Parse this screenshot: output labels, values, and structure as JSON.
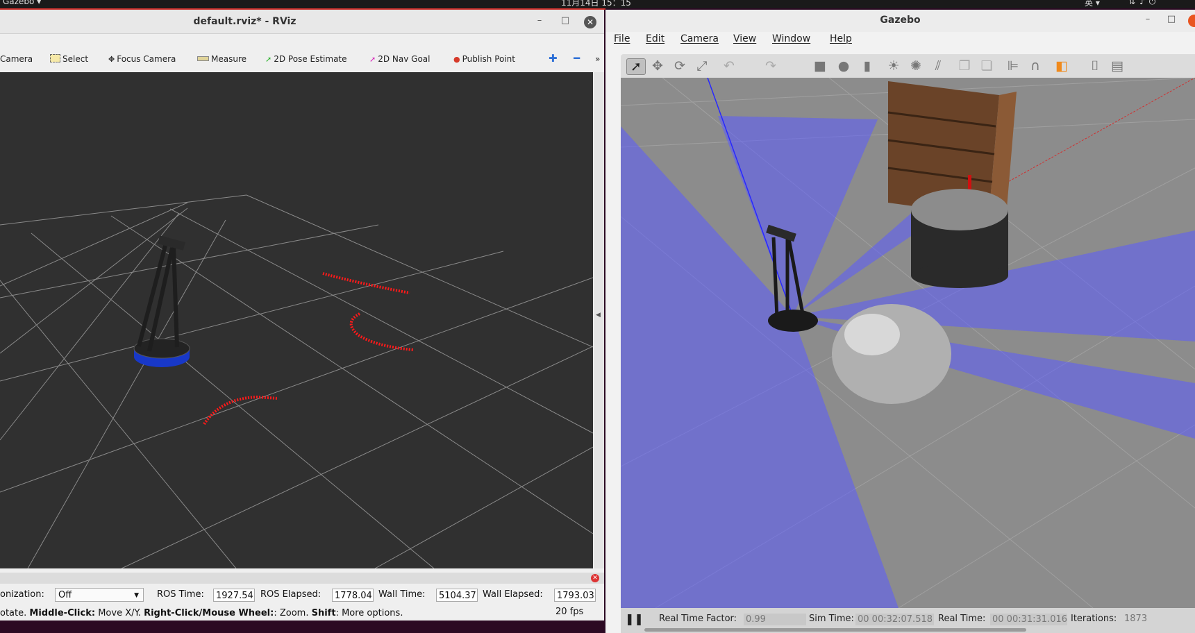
{
  "topbar": {
    "app_menu": "Gazebo ▾",
    "clock": "11月14日  15：15",
    "input_method": "英 ▾",
    "tray_icons": [
      "network-icon",
      "volume-icon",
      "power-icon"
    ]
  },
  "rviz": {
    "window_title": "default.rviz* - RViz",
    "toolbar": {
      "camera": "Camera",
      "select": "Select",
      "focus_camera": "Focus Camera",
      "measure": "Measure",
      "pose_estimate": "2D Pose Estimate",
      "nav_goal": "2D Nav Goal",
      "publish_point": "Publish Point",
      "more": "»"
    },
    "time_panel": {
      "sync_label": "onization:",
      "sync_value": "Off",
      "ros_time_label": "ROS Time:",
      "ros_time_value": "1927.54",
      "ros_elapsed_label": "ROS Elapsed:",
      "ros_elapsed_value": "1778.04",
      "wall_time_label": "Wall Time:",
      "wall_time_value": "5104.37",
      "wall_elapsed_label": "Wall Elapsed:",
      "wall_elapsed_value": "1793.03"
    },
    "hint": {
      "part1": "otate. ",
      "middle_click": "Middle-Click:",
      "part2": " Move X/Y. ",
      "right_click": "Right-Click/Mouse Wheel:",
      "part3": ": Zoom. ",
      "shift": "Shift",
      "part4": ": More options."
    },
    "fps": "20 fps"
  },
  "gazebo": {
    "window_title": "Gazebo",
    "menu": [
      "File",
      "Edit",
      "Camera",
      "View",
      "Window",
      "Help"
    ],
    "status": {
      "real_time_factor_label": "Real Time Factor:",
      "real_time_factor_value": "0.99",
      "sim_time_label": "Sim Time:",
      "sim_time_value": "00 00:32:07.518",
      "real_time_label": "Real Time:",
      "real_time_value": "00 00:31:31.016",
      "iterations_label": "Iterations:",
      "iterations_value": "1873"
    }
  },
  "colors": {
    "rviz_background": "#303030",
    "laser_points": "#ff1a1a",
    "laser_rays": "#3a3aff",
    "gazebo_ground": "#8c8c8c"
  }
}
